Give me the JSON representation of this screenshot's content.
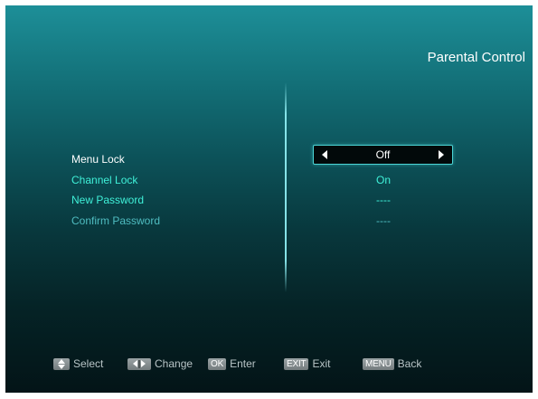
{
  "screen": {
    "title": "Parental Control"
  },
  "menu": {
    "items": [
      {
        "label": "Menu Lock",
        "value": "Off"
      },
      {
        "label": "Channel Lock",
        "value": "On"
      },
      {
        "label": "New Password",
        "value": "----"
      },
      {
        "label": "Confirm Password",
        "value": "----"
      }
    ]
  },
  "footer": {
    "select": {
      "key_icon": "up-down-arrows",
      "label": "Select"
    },
    "change": {
      "key_icon": "left-right-arrows",
      "label": "Change"
    },
    "enter": {
      "key": "OK",
      "label": "Enter"
    },
    "exit": {
      "key": "EXIT",
      "label": "Exit"
    },
    "back": {
      "key": "MENU",
      "label": "Back"
    }
  },
  "colors": {
    "background_top": "#1d8f98",
    "background_bottom": "#031417",
    "highlight": "#3ff0d8",
    "selector_border": "#4cd6d6"
  }
}
